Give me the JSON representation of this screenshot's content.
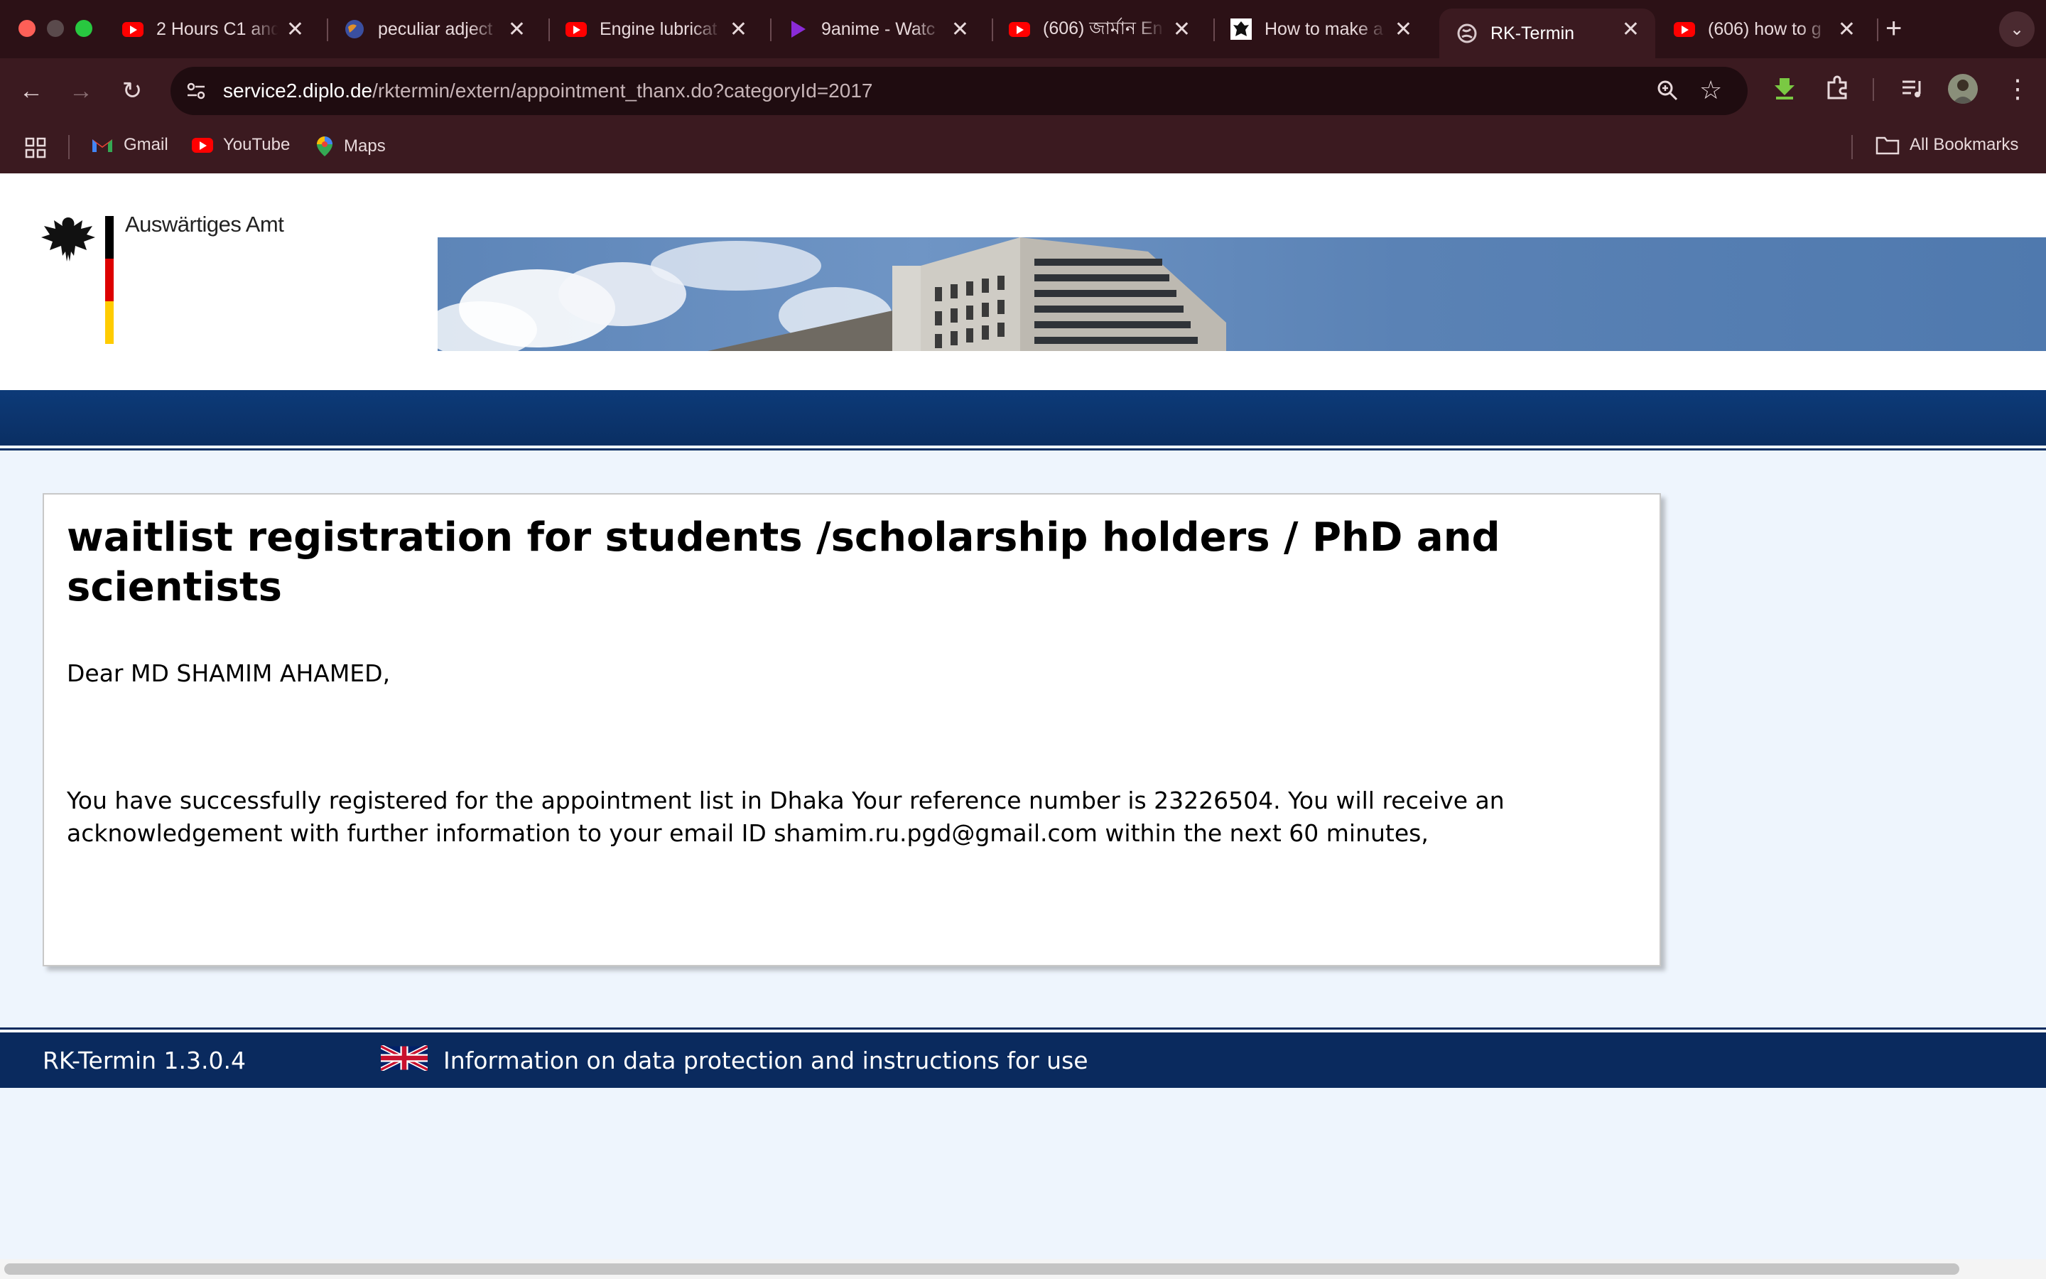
{
  "browser": {
    "tabs": [
      {
        "title": "2 Hours C1 and",
        "icon": "youtube-icon"
      },
      {
        "title": "peculiar adject",
        "icon": "globe-icon"
      },
      {
        "title": "Engine lubricat",
        "icon": "youtube-icon"
      },
      {
        "title": "9anime - Watc",
        "icon": "play-icon"
      },
      {
        "title": "(606) জার্মান En",
        "icon": "youtube-icon"
      },
      {
        "title": "How to make a",
        "icon": "eagle-icon"
      },
      {
        "title": "RK-Termin",
        "icon": "globe-icon",
        "active": true
      },
      {
        "title": "(606) how to g",
        "icon": "youtube-icon"
      }
    ],
    "url_host": "service2.diplo.de",
    "url_path": "/rktermin/extern/appointment_thanx.do?categoryId=2017",
    "bookmarks": [
      "Gmail",
      "YouTube",
      "Maps"
    ],
    "all_bookmarks": "All Bookmarks"
  },
  "header": {
    "logo_text": "Auswärtiges Amt"
  },
  "content": {
    "heading": "waitlist registration for students /scholarship holders / PhD and scientists",
    "greeting": "Dear MD SHAMIM AHAMED,",
    "message": "You have successfully registered for the appointment list in Dhaka Your reference number is 23226504. You will receive an acknowledgement with further information to your email ID shamim.ru.pgd@gmail.com within the next 60 minutes,"
  },
  "footer": {
    "version": "RK-Termin 1.3.0.4",
    "info_link": "Information on data protection and instructions for use"
  },
  "colors": {
    "tab_strip": "#2c1116",
    "toolbar": "#3b1a20",
    "nav_blue": "#0a2f63",
    "page_bg": "#eef5fd"
  }
}
